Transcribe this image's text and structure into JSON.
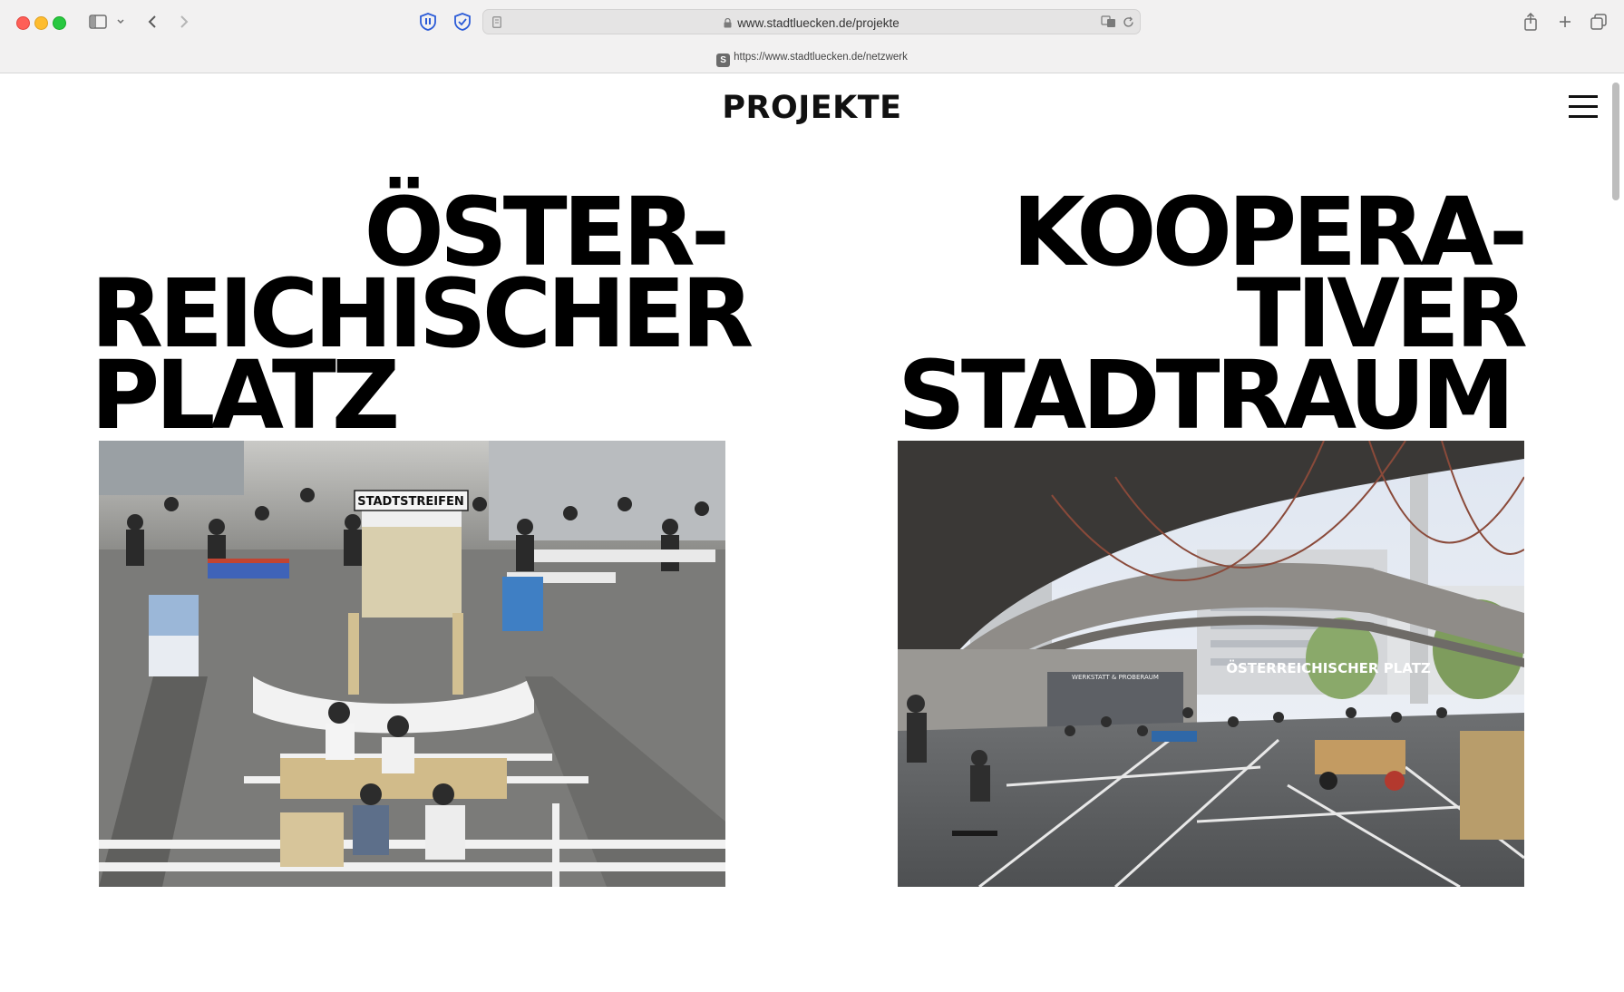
{
  "browser": {
    "url": "www.stadtluecken.de/projekte",
    "hover_link": "https://www.stadtluecken.de/netzwerk",
    "favicon_letter": "S"
  },
  "page": {
    "title": "PROJEKTE",
    "projects": [
      {
        "title_lines": [
          "ÖSTER-",
          "REICHISCHER",
          "PLATZ"
        ],
        "sign_text": "STADTSTREIFEN"
      },
      {
        "title_lines": [
          "KOOPERA-",
          "TIVER",
          "STADTRAUM"
        ],
        "sign_text": "ÖSTERREICHISCHER PLATZ",
        "small_sign_text": "WERKSTATT & PROBERAUM"
      }
    ]
  }
}
